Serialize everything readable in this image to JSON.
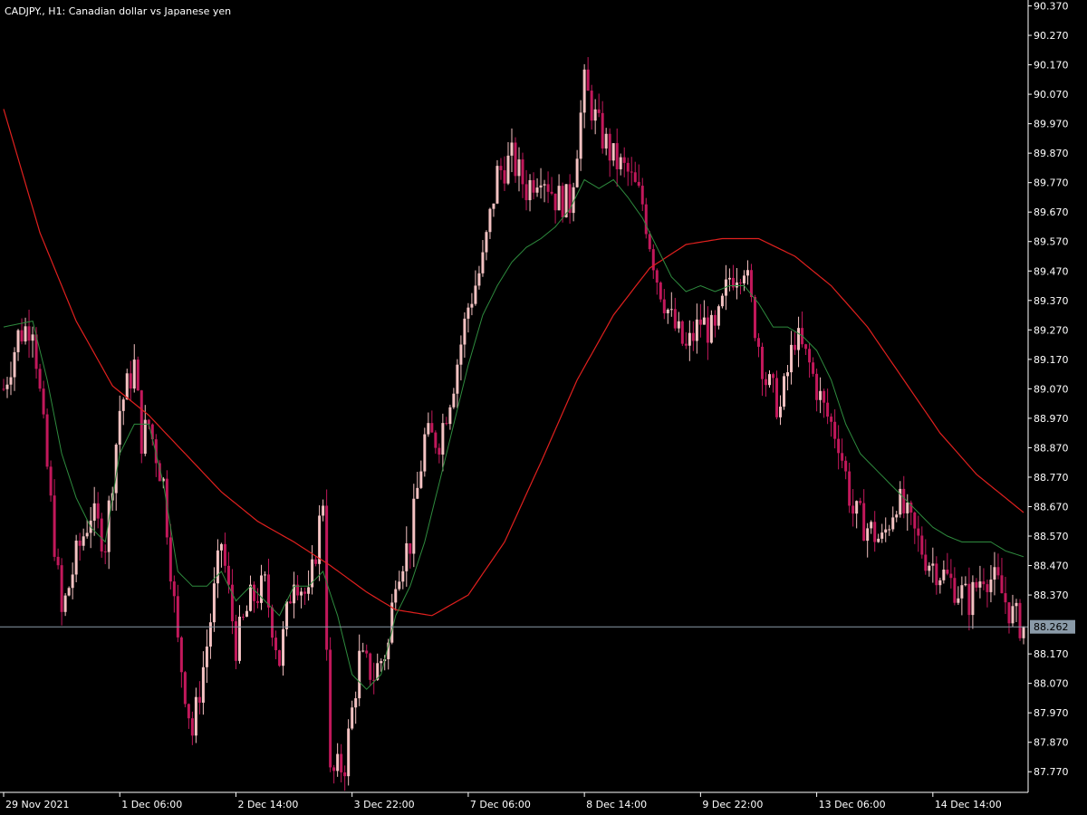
{
  "header": {
    "symbol": "CADJPY.",
    "timeframe": "H1",
    "description": "Canadian dollar vs Japanese yen",
    "title_text": "CADJPY., H1:  Canadian dollar vs Japanese yen"
  },
  "colors": {
    "background": "#000000",
    "axis": "#ffffff",
    "bull_candle": "#f4c2c2",
    "bear_candle": "#c2185b",
    "fast_ma": "#2e8b3e",
    "slow_ma": "#e0201e",
    "current_price_line": "#8a9aa8",
    "current_price_badge": "#8a9aa8"
  },
  "current_price": "88.262",
  "chart_data": {
    "type": "candlestick",
    "ylim": [
      87.7,
      90.39
    ],
    "y_ticks": [
      "90.370",
      "90.270",
      "90.170",
      "90.070",
      "89.970",
      "89.870",
      "89.770",
      "89.670",
      "89.570",
      "89.470",
      "89.370",
      "89.270",
      "89.170",
      "89.070",
      "88.970",
      "88.870",
      "88.770",
      "88.670",
      "88.570",
      "88.470",
      "88.370",
      "88.170",
      "88.070",
      "87.970",
      "87.870",
      "87.770"
    ],
    "x_ticks": [
      "29 Nov 2021",
      "1 Dec 06:00",
      "2 Dec 14:00",
      "3 Dec 22:00",
      "7 Dec 06:00",
      "8 Dec 14:00",
      "9 Dec 22:00",
      "13 Dec 06:00",
      "14 Dec 14:00"
    ],
    "x_tick_bar_index": [
      0,
      32,
      64,
      96,
      128,
      160,
      192,
      224,
      256
    ],
    "bar_count": 282,
    "close_path": [
      [
        0,
        89.07
      ],
      [
        4,
        89.25
      ],
      [
        8,
        89.3
      ],
      [
        12,
        88.8
      ],
      [
        16,
        88.3
      ],
      [
        20,
        88.5
      ],
      [
        24,
        88.65
      ],
      [
        28,
        88.55
      ],
      [
        32,
        89.0
      ],
      [
        36,
        89.15
      ],
      [
        38,
        88.9
      ],
      [
        40,
        88.95
      ],
      [
        44,
        88.75
      ],
      [
        48,
        88.2
      ],
      [
        52,
        87.9
      ],
      [
        56,
        88.2
      ],
      [
        60,
        88.55
      ],
      [
        64,
        88.2
      ],
      [
        68,
        88.35
      ],
      [
        72,
        88.4
      ],
      [
        76,
        88.15
      ],
      [
        80,
        88.45
      ],
      [
        84,
        88.35
      ],
      [
        88,
        88.7
      ],
      [
        90,
        87.75
      ],
      [
        94,
        87.8
      ],
      [
        98,
        88.15
      ],
      [
        102,
        88.1
      ],
      [
        106,
        88.2
      ],
      [
        108,
        88.45
      ],
      [
        112,
        88.55
      ],
      [
        116,
        88.9
      ],
      [
        120,
        88.9
      ],
      [
        124,
        89.1
      ],
      [
        128,
        89.35
      ],
      [
        132,
        89.5
      ],
      [
        136,
        89.8
      ],
      [
        140,
        89.85
      ],
      [
        144,
        89.75
      ],
      [
        148,
        89.82
      ],
      [
        152,
        89.72
      ],
      [
        156,
        89.7
      ],
      [
        160,
        90.1
      ],
      [
        164,
        89.95
      ],
      [
        168,
        89.85
      ],
      [
        172,
        89.8
      ],
      [
        176,
        89.7
      ],
      [
        180,
        89.45
      ],
      [
        184,
        89.3
      ],
      [
        188,
        89.2
      ],
      [
        192,
        89.3
      ],
      [
        196,
        89.25
      ],
      [
        200,
        89.45
      ],
      [
        204,
        89.5
      ],
      [
        206,
        89.35
      ],
      [
        210,
        89.1
      ],
      [
        214,
        89.0
      ],
      [
        218,
        89.25
      ],
      [
        222,
        89.15
      ],
      [
        226,
        89.0
      ],
      [
        230,
        88.9
      ],
      [
        234,
        88.65
      ],
      [
        238,
        88.6
      ],
      [
        242,
        88.55
      ],
      [
        246,
        88.7
      ],
      [
        250,
        88.6
      ],
      [
        254,
        88.5
      ],
      [
        258,
        88.45
      ],
      [
        262,
        88.4
      ],
      [
        266,
        88.35
      ],
      [
        270,
        88.45
      ],
      [
        274,
        88.4
      ],
      [
        278,
        88.3
      ],
      [
        281,
        88.262
      ]
    ],
    "fast_ma_path": [
      [
        0,
        89.28
      ],
      [
        8,
        89.3
      ],
      [
        12,
        89.1
      ],
      [
        16,
        88.85
      ],
      [
        20,
        88.7
      ],
      [
        24,
        88.6
      ],
      [
        28,
        88.55
      ],
      [
        32,
        88.85
      ],
      [
        36,
        88.95
      ],
      [
        40,
        88.95
      ],
      [
        44,
        88.75
      ],
      [
        48,
        88.45
      ],
      [
        52,
        88.4
      ],
      [
        56,
        88.4
      ],
      [
        60,
        88.45
      ],
      [
        64,
        88.35
      ],
      [
        68,
        88.4
      ],
      [
        72,
        88.35
      ],
      [
        76,
        88.3
      ],
      [
        80,
        88.4
      ],
      [
        84,
        88.4
      ],
      [
        88,
        88.45
      ],
      [
        92,
        88.3
      ],
      [
        96,
        88.1
      ],
      [
        100,
        88.05
      ],
      [
        104,
        88.1
      ],
      [
        108,
        88.3
      ],
      [
        112,
        88.4
      ],
      [
        116,
        88.55
      ],
      [
        120,
        88.75
      ],
      [
        124,
        88.95
      ],
      [
        128,
        89.15
      ],
      [
        132,
        89.32
      ],
      [
        136,
        89.42
      ],
      [
        140,
        89.5
      ],
      [
        144,
        89.55
      ],
      [
        148,
        89.58
      ],
      [
        152,
        89.62
      ],
      [
        156,
        89.68
      ],
      [
        160,
        89.78
      ],
      [
        164,
        89.75
      ],
      [
        168,
        89.78
      ],
      [
        172,
        89.72
      ],
      [
        176,
        89.65
      ],
      [
        180,
        89.55
      ],
      [
        184,
        89.45
      ],
      [
        188,
        89.4
      ],
      [
        192,
        89.42
      ],
      [
        196,
        89.4
      ],
      [
        200,
        89.42
      ],
      [
        204,
        89.42
      ],
      [
        208,
        89.36
      ],
      [
        212,
        89.28
      ],
      [
        216,
        89.28
      ],
      [
        220,
        89.25
      ],
      [
        224,
        89.2
      ],
      [
        228,
        89.1
      ],
      [
        232,
        88.95
      ],
      [
        236,
        88.85
      ],
      [
        240,
        88.8
      ],
      [
        244,
        88.75
      ],
      [
        248,
        88.7
      ],
      [
        252,
        88.65
      ],
      [
        256,
        88.6
      ],
      [
        260,
        88.57
      ],
      [
        264,
        88.55
      ],
      [
        268,
        88.55
      ],
      [
        272,
        88.55
      ],
      [
        276,
        88.52
      ],
      [
        281,
        88.5
      ]
    ],
    "slow_ma_path": [
      [
        0,
        90.02
      ],
      [
        10,
        89.6
      ],
      [
        20,
        89.3
      ],
      [
        30,
        89.08
      ],
      [
        40,
        88.98
      ],
      [
        50,
        88.85
      ],
      [
        60,
        88.72
      ],
      [
        70,
        88.62
      ],
      [
        80,
        88.55
      ],
      [
        90,
        88.47
      ],
      [
        100,
        88.38
      ],
      [
        108,
        88.32
      ],
      [
        118,
        88.3
      ],
      [
        128,
        88.37
      ],
      [
        138,
        88.55
      ],
      [
        148,
        88.82
      ],
      [
        158,
        89.1
      ],
      [
        168,
        89.32
      ],
      [
        178,
        89.48
      ],
      [
        188,
        89.56
      ],
      [
        198,
        89.58
      ],
      [
        208,
        89.58
      ],
      [
        218,
        89.52
      ],
      [
        228,
        89.42
      ],
      [
        238,
        89.28
      ],
      [
        248,
        89.1
      ],
      [
        258,
        88.92
      ],
      [
        268,
        88.78
      ],
      [
        276,
        88.7
      ],
      [
        281,
        88.65
      ]
    ]
  }
}
